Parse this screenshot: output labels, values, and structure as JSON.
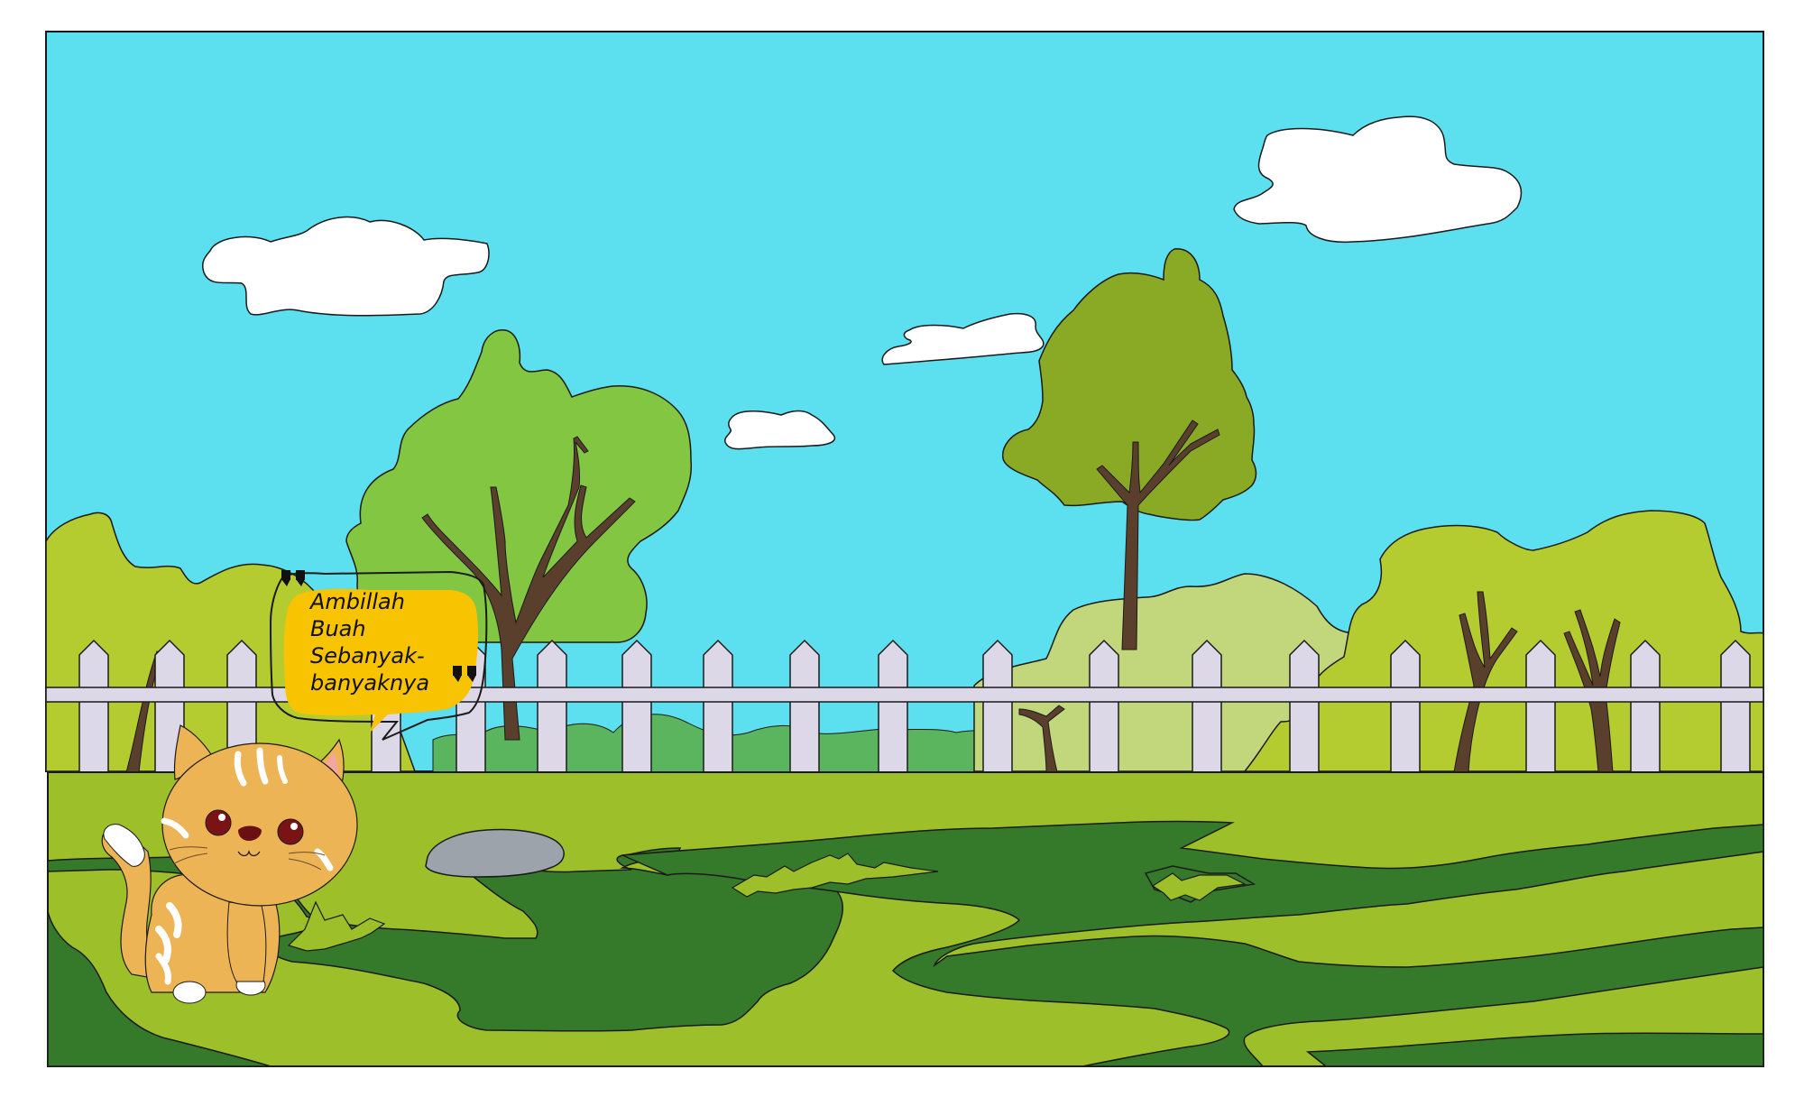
{
  "game": {
    "dialogue": {
      "speaker": "cat",
      "lines": [
        "Ambillah",
        "Buah",
        "Sebanyak-",
        "banyaknya"
      ]
    }
  },
  "colors": {
    "sky": "#5CDFEE",
    "cloud": "#FFFFFF",
    "tree_bright": "#82C641",
    "tree_olive": "#8AAA25",
    "bush_yellow_green": "#B5CC30",
    "bush_pale": "#C2D67C",
    "hedge_green": "#5AB55E",
    "trunk": "#5A3F2C",
    "fence": "#DCD8E8",
    "grass_light": "#9DC02A",
    "grass_dark": "#357A2A",
    "rock": "#9DA3AB",
    "speech_bubble": "#F8C300",
    "cat_body": "#EDB456",
    "cat_stripe": "#FFFFFF",
    "cat_eye": "#7A1414",
    "cat_ear_inner": "#F4A6A0"
  },
  "icons": [
    "quote-open-icon",
    "quote-close-icon"
  ]
}
